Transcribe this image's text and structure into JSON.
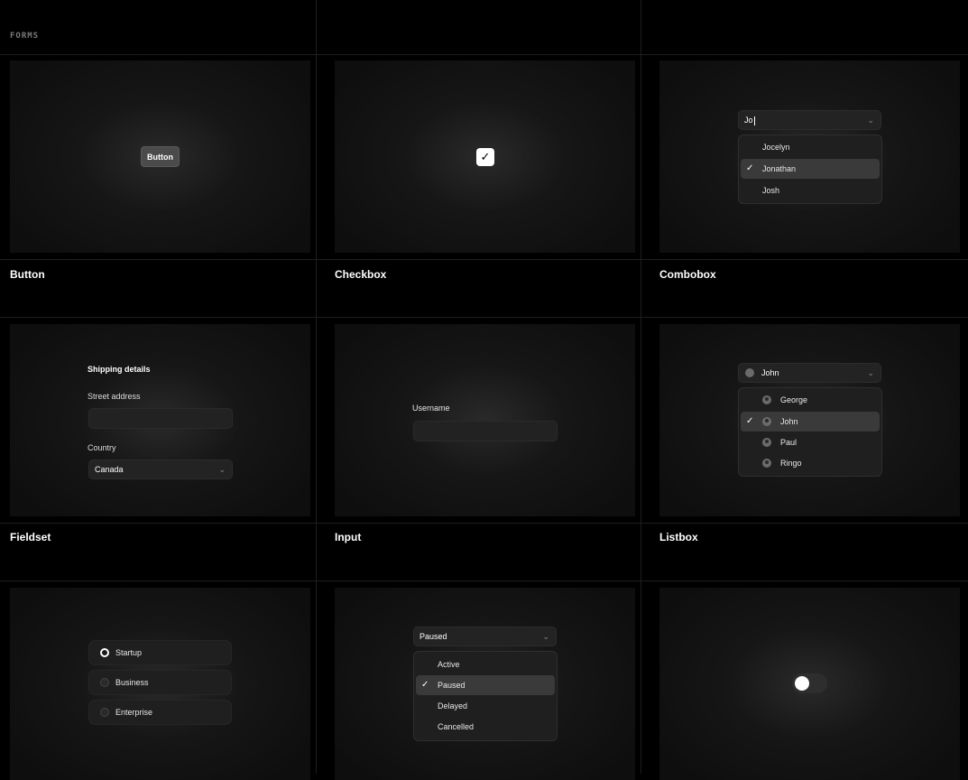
{
  "section": {
    "label": "FORMS"
  },
  "cards": {
    "button": {
      "title": "Button",
      "label": "Button"
    },
    "checkbox": {
      "title": "Checkbox",
      "mark": "✓",
      "checked": true
    },
    "combobox": {
      "title": "Combobox",
      "value": "Jo",
      "options": [
        "Jocelyn",
        "Jonathan",
        "Josh"
      ],
      "selected": "Jonathan",
      "check": "✓",
      "chevron": "⌄"
    },
    "fieldset": {
      "title": "Fieldset",
      "legend": "Shipping details",
      "street_label": "Street address",
      "street_value": "",
      "country_label": "Country",
      "country_value": "Canada",
      "chevron": "⌄"
    },
    "input": {
      "title": "Input",
      "label": "Username",
      "value": ""
    },
    "listbox": {
      "title": "Listbox",
      "value": "John",
      "options": [
        "George",
        "John",
        "Paul",
        "Ringo"
      ],
      "selected": "John",
      "check": "✓",
      "chevron": "⌄"
    },
    "radio": {
      "options": [
        "Startup",
        "Business",
        "Enterprise"
      ],
      "selected": "Startup"
    },
    "select": {
      "value": "Paused",
      "options": [
        "Active",
        "Paused",
        "Delayed",
        "Cancelled"
      ],
      "selected": "Paused",
      "check": "✓",
      "chevron": "⌄"
    },
    "switch": {
      "on": false
    }
  }
}
